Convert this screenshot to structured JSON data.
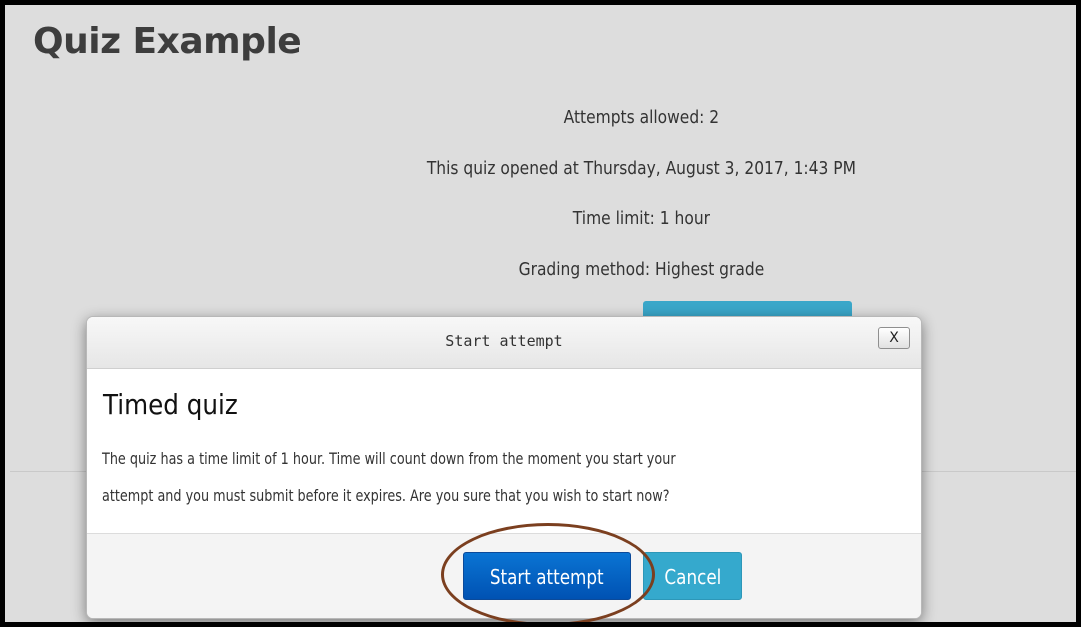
{
  "page": {
    "title": "Quiz Example",
    "info": [
      "Attempts allowed: 2",
      "This quiz opened at Thursday, August 3, 2017, 1:43 PM",
      "Time limit: 1 hour",
      "Grading method: Highest grade"
    ]
  },
  "dialog": {
    "title": "Start attempt",
    "close_label": "X",
    "heading": "Timed quiz",
    "message_line1": "The quiz has a time limit of 1 hour. Time will count down from the moment you start your",
    "message_line2": "attempt and you must submit before it expires. Are you sure that you wish to start now?",
    "primary_button": "Start attempt",
    "cancel_button": "Cancel"
  },
  "colors": {
    "page_background": "#dddddd",
    "primary_button": "#0a6fd0",
    "cancel_button": "#35a9cd",
    "highlight_ring": "#7b3f1f"
  }
}
